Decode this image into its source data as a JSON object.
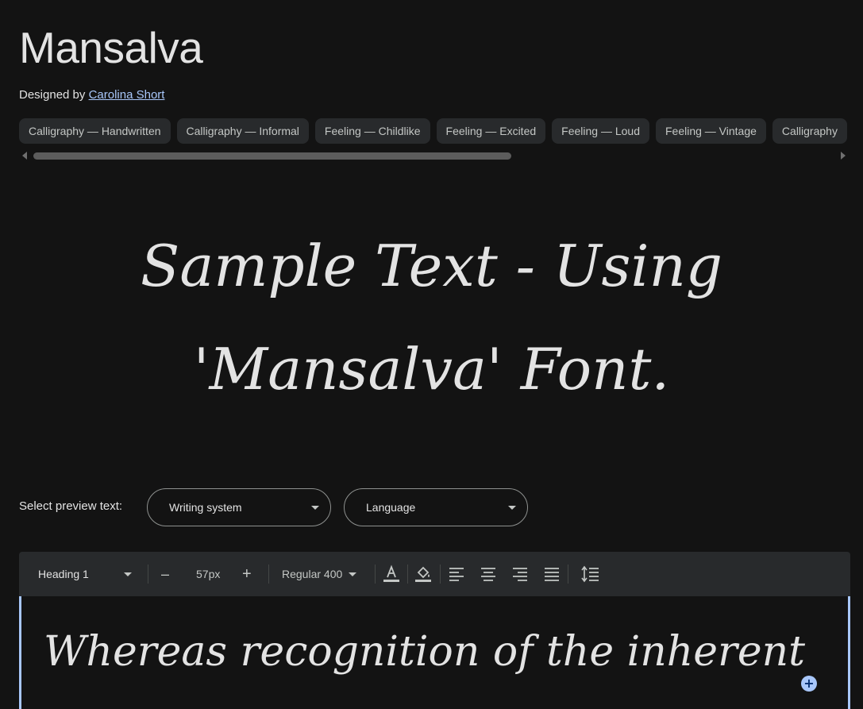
{
  "font": {
    "name": "Mansalva",
    "designed_by_label": "Designed by",
    "designer": "Carolina Short"
  },
  "tags": [
    "Calligraphy — Handwritten",
    "Calligraphy — Informal",
    "Feeling — Childlike",
    "Feeling — Excited",
    "Feeling — Loud",
    "Feeling — Vintage",
    "Calligraphy"
  ],
  "sample": {
    "line1": "Sample Text - Using",
    "line2": "'Mansalva' Font."
  },
  "preview": {
    "label": "Select preview text:",
    "writing_system": "Writing system",
    "language": "Language"
  },
  "toolbar": {
    "style": "Heading 1",
    "decrease": "–",
    "size": "57px",
    "increase": "+",
    "weight": "Regular 400"
  },
  "editor": {
    "text": "Whereas recognition of the inherent"
  },
  "colors": {
    "background": "#131313",
    "chip_background": "#282a2c",
    "link": "#a8c7fa",
    "accent": "#a8c7fa"
  }
}
